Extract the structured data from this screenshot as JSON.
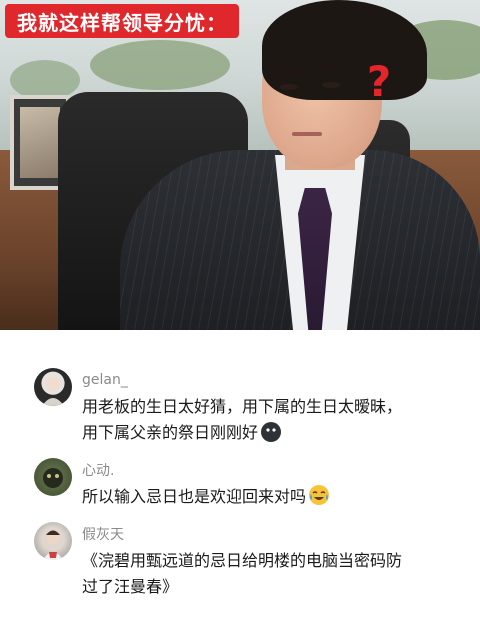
{
  "caption": "我就这样帮领导分忧：",
  "photo": {
    "question_mark": "?"
  },
  "comments": [
    {
      "username": "gelan_",
      "lines": [
        "用老板的生日太好猜，用下属的生日太暧昧，",
        "用下属父亲的祭日刚刚好"
      ],
      "emoji": "dark-blob-emoji"
    },
    {
      "username": "心动.",
      "lines": [
        "所以输入忌日也是欢迎回来对吗"
      ],
      "emoji": "tears-of-joy-emoji"
    },
    {
      "username": "假灰天",
      "lines": [
        "《浣碧用甄远道的忌日给明楼的电脑当密码防",
        "过了汪曼春》"
      ]
    }
  ],
  "colors": {
    "caption_bg": "#e0272b",
    "caption_text": "#ffffff",
    "question_mark": "#e3262b",
    "username": "#8a8a8a",
    "comment_text": "#1a1a1a"
  }
}
